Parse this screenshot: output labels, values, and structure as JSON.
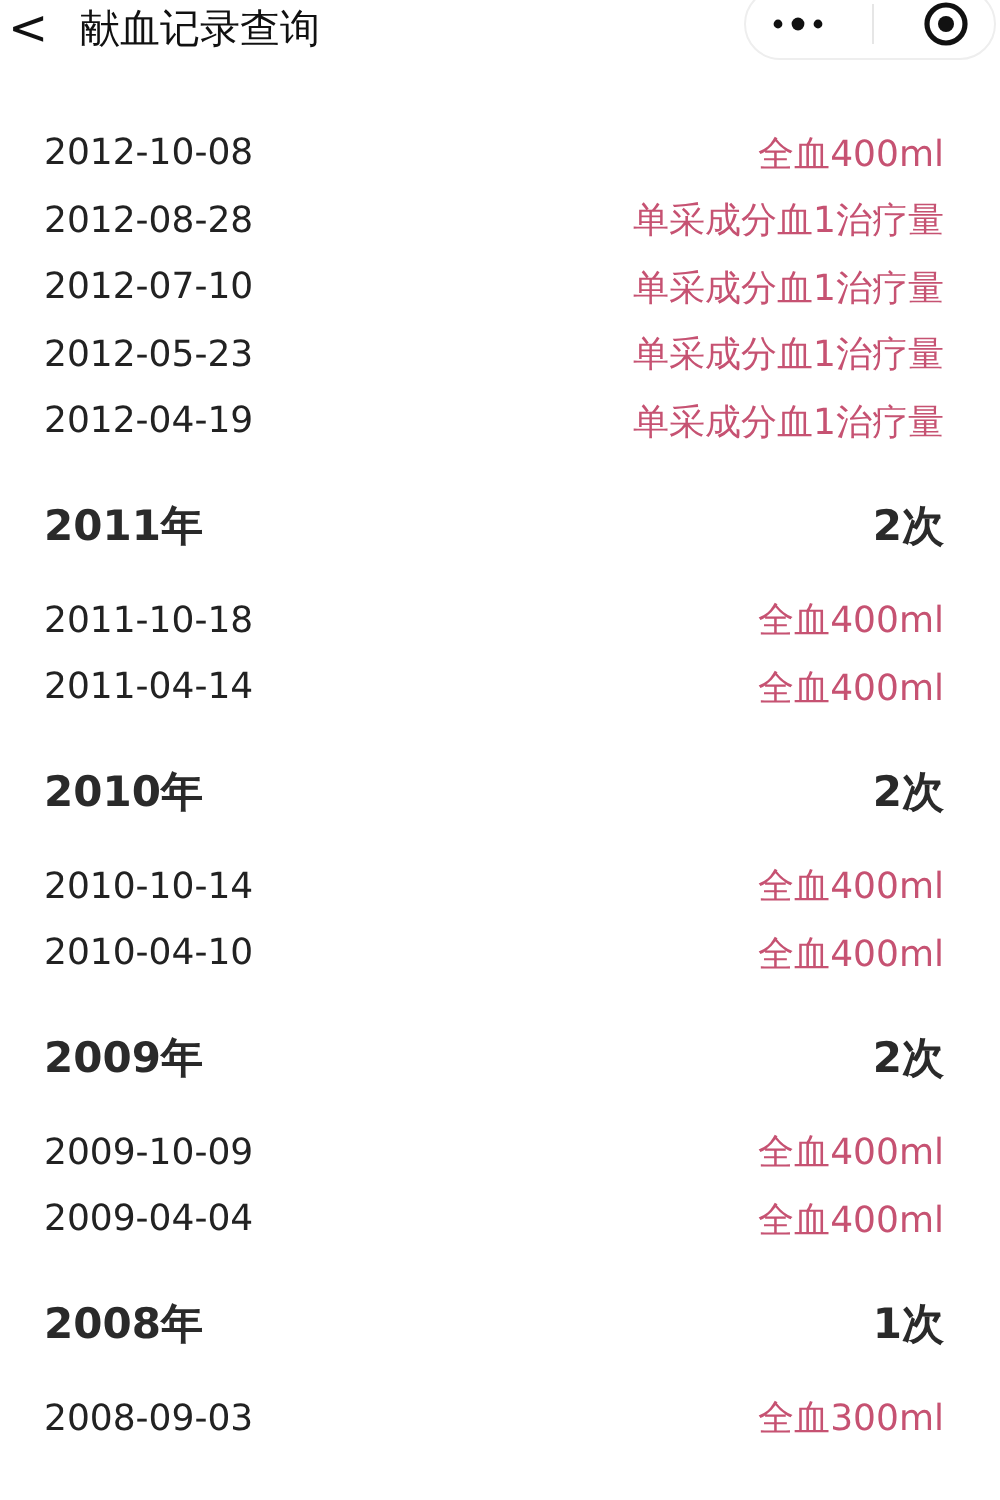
{
  "header": {
    "back_icon": "<",
    "title": "献血记录查询"
  },
  "groups": [
    {
      "records": [
        {
          "date": "2012-10-08",
          "type": "全血400ml"
        },
        {
          "date": "2012-08-28",
          "type": "单采成分血1治疗量"
        },
        {
          "date": "2012-07-10",
          "type": "单采成分血1治疗量"
        },
        {
          "date": "2012-05-23",
          "type": "单采成分血1治疗量"
        },
        {
          "date": "2012-04-19",
          "type": "单采成分血1治疗量"
        }
      ]
    },
    {
      "year": "2011年",
      "count": "2次",
      "records": [
        {
          "date": "2011-10-18",
          "type": "全血400ml"
        },
        {
          "date": "2011-04-14",
          "type": "全血400ml"
        }
      ]
    },
    {
      "year": "2010年",
      "count": "2次",
      "records": [
        {
          "date": "2010-10-14",
          "type": "全血400ml"
        },
        {
          "date": "2010-04-10",
          "type": "全血400ml"
        }
      ]
    },
    {
      "year": "2009年",
      "count": "2次",
      "records": [
        {
          "date": "2009-10-09",
          "type": "全血400ml"
        },
        {
          "date": "2009-04-04",
          "type": "全血400ml"
        }
      ]
    },
    {
      "year": "2008年",
      "count": "1次",
      "records": [
        {
          "date": "2008-09-03",
          "type": "全血300ml"
        }
      ]
    }
  ]
}
